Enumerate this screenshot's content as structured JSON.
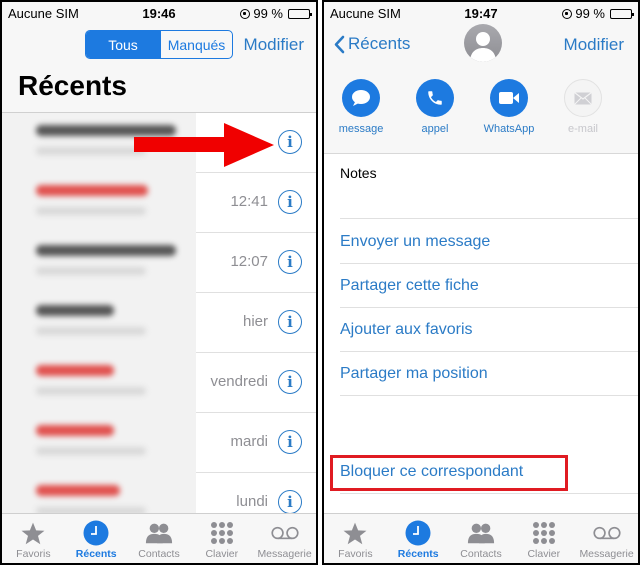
{
  "left_screen": {
    "status": {
      "carrier": "Aucune SIM",
      "time": "19:46",
      "battery": "99 %"
    },
    "segmented": {
      "options": [
        "Tous",
        "Manqués"
      ],
      "selected": "Tous"
    },
    "edit_label": "Modifier",
    "title": "Récents",
    "calls": [
      {
        "time": "",
        "missed": false,
        "name_blurred": true
      },
      {
        "time": "12:41",
        "missed": true,
        "name_blurred": true
      },
      {
        "time": "12:07",
        "missed": false,
        "name_blurred": true
      },
      {
        "time": "hier",
        "missed": false,
        "name_blurred": true
      },
      {
        "time": "vendredi",
        "missed": true,
        "name_blurred": true
      },
      {
        "time": "mardi",
        "missed": true,
        "name_blurred": true
      },
      {
        "time": "lundi",
        "missed": true,
        "name_blurred": true
      }
    ],
    "annotation": "red-arrow-pointing-to-info-button"
  },
  "right_screen": {
    "status": {
      "carrier": "Aucune SIM",
      "time": "19:47",
      "battery": "99 %"
    },
    "back_label": "Récents",
    "edit_label": "Modifier",
    "actions": [
      {
        "label": "message",
        "icon": "message-bubble-icon",
        "enabled": true
      },
      {
        "label": "appel",
        "icon": "phone-icon",
        "enabled": true
      },
      {
        "label": "WhatsApp",
        "icon": "video-camera-icon",
        "enabled": true
      },
      {
        "label": "e-mail",
        "icon": "envelope-icon",
        "enabled": false
      }
    ],
    "notes_label": "Notes",
    "options": [
      "Envoyer un message",
      "Partager cette fiche",
      "Ajouter aux favoris",
      "Partager ma position"
    ],
    "block_label": "Bloquer ce correspondant",
    "annotation": "red-box-highlighting-block-option"
  },
  "tabbar": {
    "tabs": [
      {
        "label": "Favoris",
        "icon": "star-icon"
      },
      {
        "label": "Récents",
        "icon": "clock-icon"
      },
      {
        "label": "Contacts",
        "icon": "contacts-icon"
      },
      {
        "label": "Clavier",
        "icon": "keypad-icon"
      },
      {
        "label": "Messagerie",
        "icon": "voicemail-icon"
      }
    ],
    "active": "Récents"
  },
  "colors": {
    "accent": "#1d7ae0",
    "link": "#2b7bc6",
    "missed": "#e0504d",
    "annotation": "#e01b22"
  }
}
